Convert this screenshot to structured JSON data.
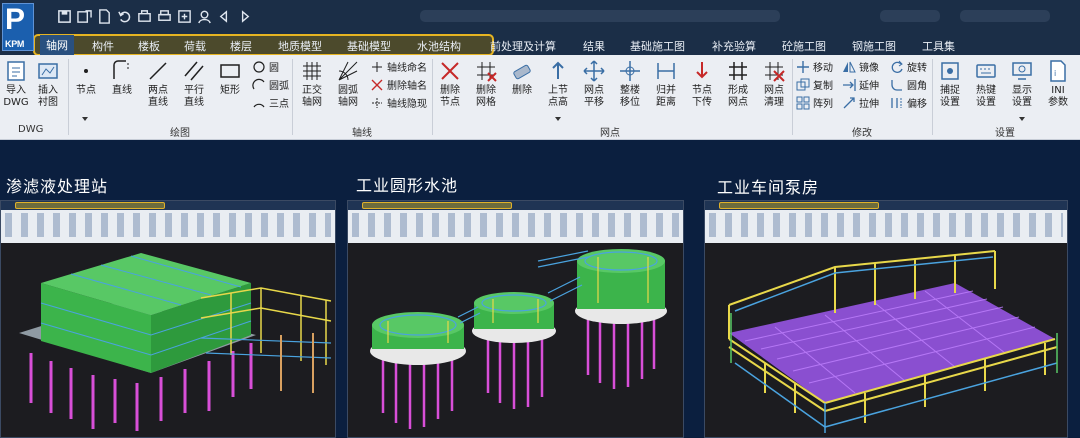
{
  "app": {
    "logo_letter": "P",
    "logo_sub": "KPM",
    "quick_access": [
      "save-icon",
      "save-as-icon",
      "new-icon",
      "undo-icon",
      "open-icon",
      "print-icon",
      "export-icon",
      "user-icon",
      "back-icon",
      "forward-icon"
    ]
  },
  "tabs": [
    {
      "label": "轴网",
      "active": true
    },
    {
      "label": "构件"
    },
    {
      "label": "楼板"
    },
    {
      "label": "荷载"
    },
    {
      "label": "楼层"
    },
    {
      "label": "地质模型"
    },
    {
      "label": "基础模型"
    },
    {
      "label": "水池结构"
    },
    {
      "label": "前处理及计算"
    },
    {
      "label": "结果"
    },
    {
      "label": "基础施工图"
    },
    {
      "label": "补充验算"
    },
    {
      "label": "砼施工图"
    },
    {
      "label": "钢施工图"
    },
    {
      "label": "工具集"
    }
  ],
  "ribbon": {
    "groups": {
      "dwg": "DWG",
      "draw": "绘图",
      "axis": "轴线",
      "node": "网点",
      "modify": "修改",
      "settings": "设置"
    },
    "dwg": {
      "import": "导入\nDWG",
      "insert": "插入\n衬图"
    },
    "draw": {
      "node": "节点",
      "line": "直线",
      "two_point": "两点\n直线",
      "parallel": "平行\n直线",
      "rect": "矩形",
      "circle": "圆",
      "arc": "圆弧",
      "three_point": "三点"
    },
    "axis": {
      "ortho": "正交\n轴网",
      "arc_grid": "圆弧\n轴网",
      "name": "轴线命名",
      "delete_name": "删除轴名",
      "hide": "轴线隐现"
    },
    "node": {
      "del_node": "删除\n节点",
      "del_grid": "删除\n网格",
      "delete": "删除",
      "node_height": "上节\n点高",
      "move": "网点\n平移",
      "floor_move": "整楼\n移位",
      "restore": "归并\n距离",
      "down": "节点\n下传",
      "form": "形成\n网点",
      "clean": "网点\n清理"
    },
    "modify": {
      "move": "移动",
      "copy": "复制",
      "array": "阵列",
      "mirror": "镜像",
      "extend": "延伸",
      "stretch": "拉伸",
      "rotate": "旋转",
      "fillet": "圆角",
      "offset": "偏移"
    },
    "settings": {
      "snap": "捕捉\n设置",
      "hotkey": "热键\n设置",
      "display": "显示\n设置",
      "ini": "INI\n参数"
    }
  },
  "gallery": [
    {
      "title": "渗滤液处理站"
    },
    {
      "title": "工业圆形水池"
    },
    {
      "title": "工业车间泵房"
    }
  ],
  "colors": {
    "titlebar": "#1b2e47",
    "highlight_border": "#e6b422",
    "background": "#0b1f3f",
    "model_green": "#3cb44b",
    "model_blue": "#4aa3df",
    "pile_magenta": "#d84fd8",
    "beam_yellow": "#e8d84a"
  }
}
